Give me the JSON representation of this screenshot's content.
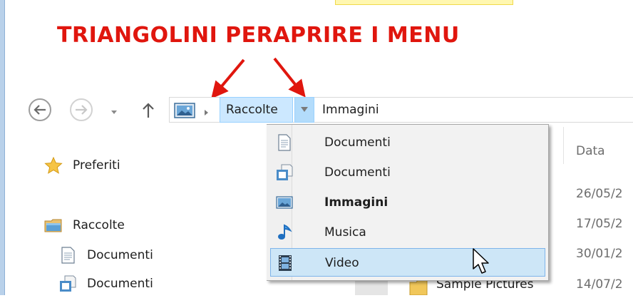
{
  "annotation": {
    "title": "TRIANGOLINI PERAPRIRE I MENU",
    "color": "#e0160e"
  },
  "address_bar": {
    "back_icon": "back-arrow-icon",
    "forward_icon": "forward-arrow-icon",
    "history_icon": "recent-locations-chevron-icon",
    "up_icon": "up-arrow-icon",
    "location_icon": "pictures-library-icon",
    "breadcrumbs": [
      {
        "label": "Raccolte",
        "active": true
      },
      {
        "label": "Immagini",
        "active": false
      }
    ]
  },
  "dropdown_menu": {
    "items": [
      {
        "label": "Documenti",
        "icon": "document-icon",
        "bold": false,
        "selected": false
      },
      {
        "label": "Documenti",
        "icon": "documents-library-icon",
        "bold": false,
        "selected": false
      },
      {
        "label": "Immagini",
        "icon": "pictures-icon",
        "bold": true,
        "selected": false
      },
      {
        "label": "Musica",
        "icon": "music-note-icon",
        "bold": false,
        "selected": false
      },
      {
        "label": "Video",
        "icon": "video-film-icon",
        "bold": false,
        "selected": true
      }
    ]
  },
  "navigation_pane": {
    "favorites": {
      "label": "Preferiti",
      "icon": "star-icon"
    },
    "libraries": {
      "label": "Raccolte",
      "icon": "libraries-folder-icon"
    },
    "children": [
      {
        "label": "Documenti",
        "icon": "document-icon"
      },
      {
        "label": "Documenti",
        "icon": "documents-library-icon"
      }
    ]
  },
  "file_list": {
    "column_header": "Data",
    "dates": [
      "26/05/2",
      "17/05/2",
      "30/01/2",
      "14/07/2"
    ],
    "visible_item": "Sample Pictures"
  },
  "colors": {
    "breadcrumb_highlight": "#cce8ff",
    "selection_border": "#7eb4ea",
    "menu_background": "#f2f2f2"
  }
}
